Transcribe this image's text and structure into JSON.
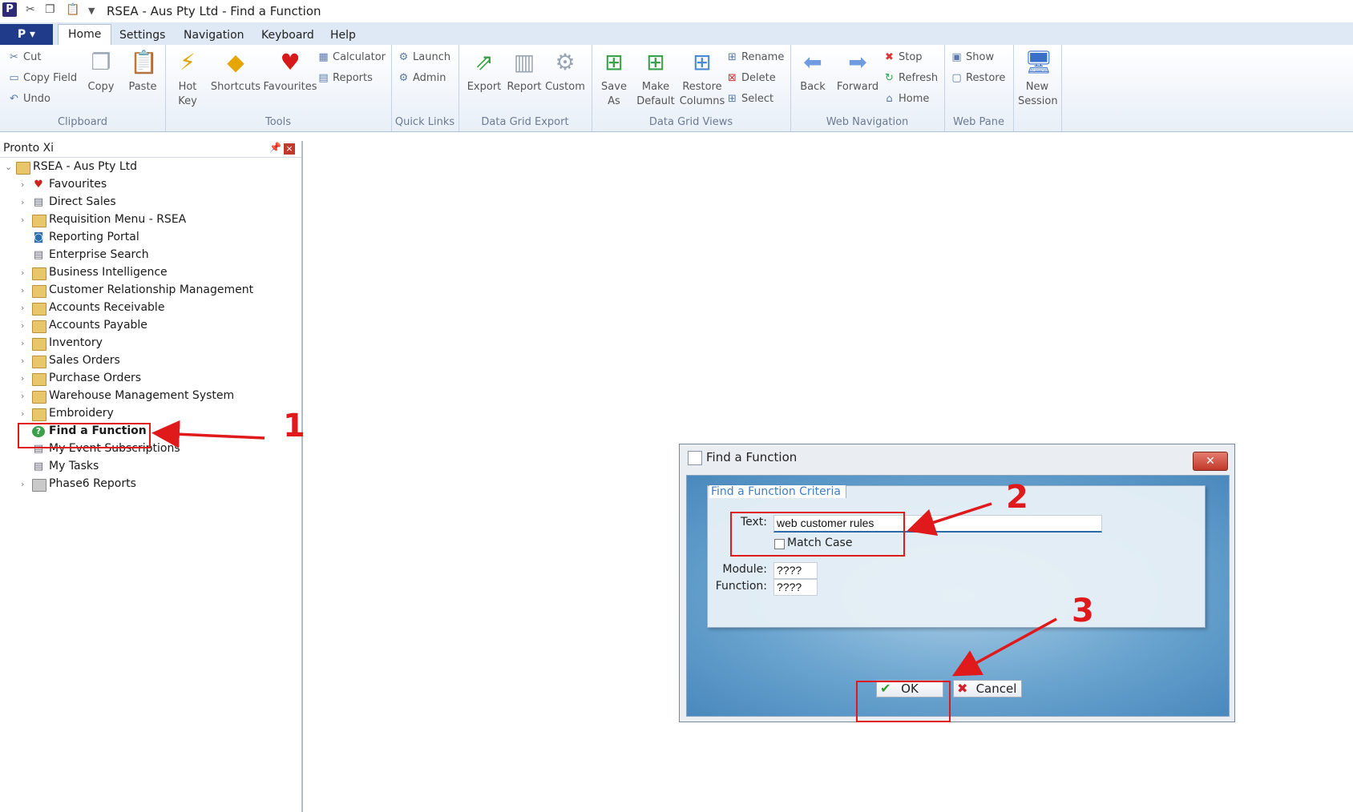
{
  "window": {
    "title": "RSEA - Aus Pty Ltd - Find a Function",
    "app_icon": "P"
  },
  "ribbon": {
    "app_button": "P",
    "tabs": [
      "Home",
      "Settings",
      "Navigation",
      "Keyboard",
      "Help"
    ],
    "active_tab": "Home",
    "groups": {
      "clipboard": {
        "label": "Clipboard",
        "cut": "Cut",
        "copy_field": "Copy Field",
        "undo": "Undo",
        "copy": "Copy",
        "paste": "Paste"
      },
      "tools": {
        "label": "Tools",
        "hot_key_1": "Hot",
        "hot_key_2": "Key",
        "shortcuts": "Shortcuts",
        "favourites": "Favourites",
        "calculator": "Calculator",
        "reports": "Reports"
      },
      "quick_links": {
        "label": "Quick Links",
        "launch": "Launch",
        "admin": "Admin"
      },
      "data_grid_export": {
        "label": "Data Grid Export",
        "export": "Export",
        "report": "Report",
        "custom": "Custom"
      },
      "data_grid_views": {
        "label": "Data Grid Views",
        "save_as_1": "Save",
        "save_as_2": "As",
        "make_default_1": "Make",
        "make_default_2": "Default",
        "restore_columns_1": "Restore",
        "restore_columns_2": "Columns",
        "rename": "Rename",
        "delete": "Delete",
        "select": "Select"
      },
      "web_navigation": {
        "label": "Web Navigation",
        "back": "Back",
        "forward": "Forward",
        "stop": "Stop",
        "refresh": "Refresh",
        "home": "Home"
      },
      "web_pane": {
        "label": "Web Pane",
        "show": "Show",
        "restore": "Restore"
      },
      "session": {
        "new_session_1": "New",
        "new_session_2": "Session"
      }
    }
  },
  "left_pane": {
    "title": "Pronto Xi",
    "root": "RSEA - Aus Pty Ltd",
    "items": [
      "Favourites",
      "Direct Sales",
      "Requisition Menu - RSEA",
      "Reporting Portal",
      "Enterprise Search",
      "Business Intelligence",
      "Customer Relationship Management",
      "Accounts Receivable",
      "Accounts Payable",
      "Inventory",
      "Sales Orders",
      "Purchase Orders",
      "Warehouse Management System",
      "Embroidery",
      "Find a Function",
      "My Event Subscriptions",
      "My Tasks",
      "Phase6 Reports"
    ]
  },
  "dialog": {
    "title": "Find a Function",
    "criteria_tab": "Find a Function Criteria",
    "text_label": "Text:",
    "text_value": "web customer rules",
    "match_case_label": "Match Case",
    "module_label": "Module:",
    "module_value": "????",
    "function_label": "Function:",
    "function_value": "????",
    "ok_label": "OK",
    "cancel_label": "Cancel"
  },
  "annotations": {
    "step1": "1",
    "step2": "2",
    "step3": "3",
    "color": "#e0191b"
  }
}
